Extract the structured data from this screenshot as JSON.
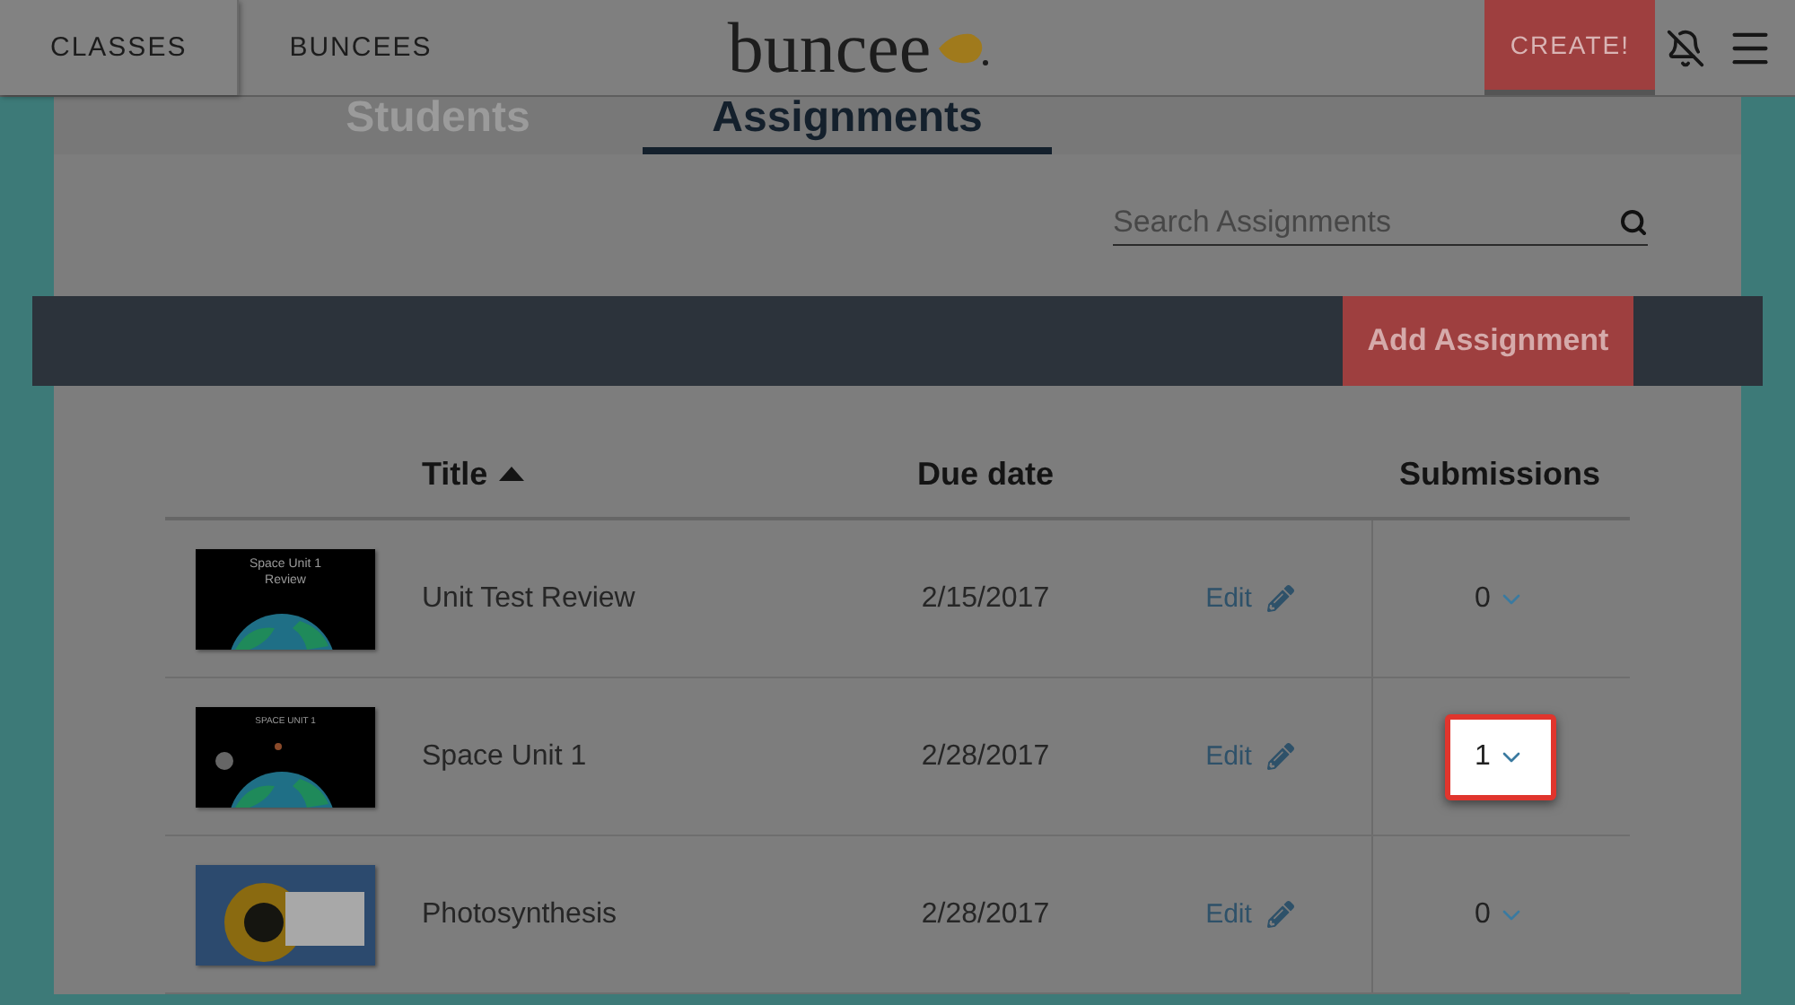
{
  "nav": {
    "links": [
      {
        "label": "CLASSES",
        "selected": true
      },
      {
        "label": "BUNCEES",
        "selected": false
      }
    ],
    "logo": "buncee",
    "create_button": "CREATE!"
  },
  "tabs": [
    {
      "label": "Students",
      "selected": false
    },
    {
      "label": "Assignments",
      "selected": true
    }
  ],
  "search": {
    "placeholder": "Search Assignments"
  },
  "add_button": "Add Assignment",
  "table": {
    "columns": [
      {
        "label": "Title",
        "sorted_ascending": true
      },
      {
        "label": "Due date"
      },
      {
        "label": "Submissions"
      }
    ],
    "rows": [
      {
        "thumbnail": {
          "kind": "slide",
          "lines": [
            "Space Unit 1",
            "Review"
          ],
          "planets": false
        },
        "title": "Unit Test Review",
        "due": "2/15/2017",
        "edit": "Edit",
        "submissions": "0",
        "highlighted": false
      },
      {
        "thumbnail": {
          "kind": "slide",
          "lines": [
            "SPACE UNIT 1"
          ],
          "planets": true
        },
        "title": "Space Unit 1",
        "due": "2/28/2017",
        "edit": "Edit",
        "submissions": "1",
        "highlighted": true
      },
      {
        "thumbnail": {
          "kind": "photo"
        },
        "title": "Photosynthesis",
        "due": "2/28/2017",
        "edit": "Edit",
        "submissions": "0",
        "highlighted": false
      }
    ]
  }
}
